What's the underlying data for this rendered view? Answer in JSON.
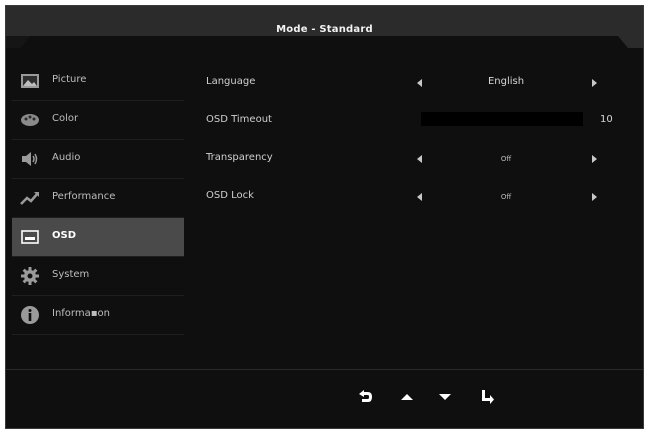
{
  "header": {
    "title": "Mode - Standard"
  },
  "sidebar": {
    "items": [
      {
        "label": "Picture",
        "icon": "picture-icon"
      },
      {
        "label": "Color",
        "icon": "palette-icon"
      },
      {
        "label": "Audio",
        "icon": "speaker-icon"
      },
      {
        "label": "Performance",
        "icon": "trend-up-icon"
      },
      {
        "label": "OSD",
        "icon": "osd-icon",
        "selected": true
      },
      {
        "label": "System",
        "icon": "gear-icon"
      },
      {
        "label": "Informa▪on",
        "icon": "info-icon"
      }
    ]
  },
  "settings": {
    "language": {
      "label": "Language",
      "value": "English"
    },
    "osd_timeout": {
      "label": "OSD Timeout",
      "value": "10"
    },
    "transparency": {
      "label": "Transparency",
      "value": "Off"
    },
    "osd_lock": {
      "label": "OSD Lock",
      "value": "Off"
    }
  },
  "footer": {
    "buttons": [
      "return-icon",
      "up-icon",
      "down-icon",
      "enter-icon"
    ]
  },
  "colors": {
    "background": "#0f0f0f",
    "selected": "#4a4a4a",
    "text": "#cfcfcf"
  }
}
